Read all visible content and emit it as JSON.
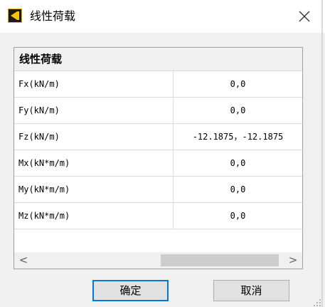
{
  "window": {
    "title": "线性荷载",
    "icon": "app-logo-icon",
    "close_icon": "close-icon"
  },
  "property_grid": {
    "group_title": "线性荷载",
    "rows": [
      {
        "name": "Fx(kN/m)",
        "value": "0,0"
      },
      {
        "name": "Fy(kN/m)",
        "value": "0,0"
      },
      {
        "name": "Fz(kN/m)",
        "value": "-12.1875，-12.1875"
      },
      {
        "name": "Mx(kN*m/m)",
        "value": "0,0"
      },
      {
        "name": "My(kN*m/m)",
        "value": "0,0"
      },
      {
        "name": "Mz(kN*m/m)",
        "value": "0,0"
      }
    ],
    "scrollbar": {
      "left_arrow": "<",
      "right_arrow": ">"
    }
  },
  "buttons": {
    "ok_label": "确定",
    "cancel_label": "取消"
  },
  "colors": {
    "accent": "#0078d7",
    "icon_accent": "#e4b100"
  }
}
